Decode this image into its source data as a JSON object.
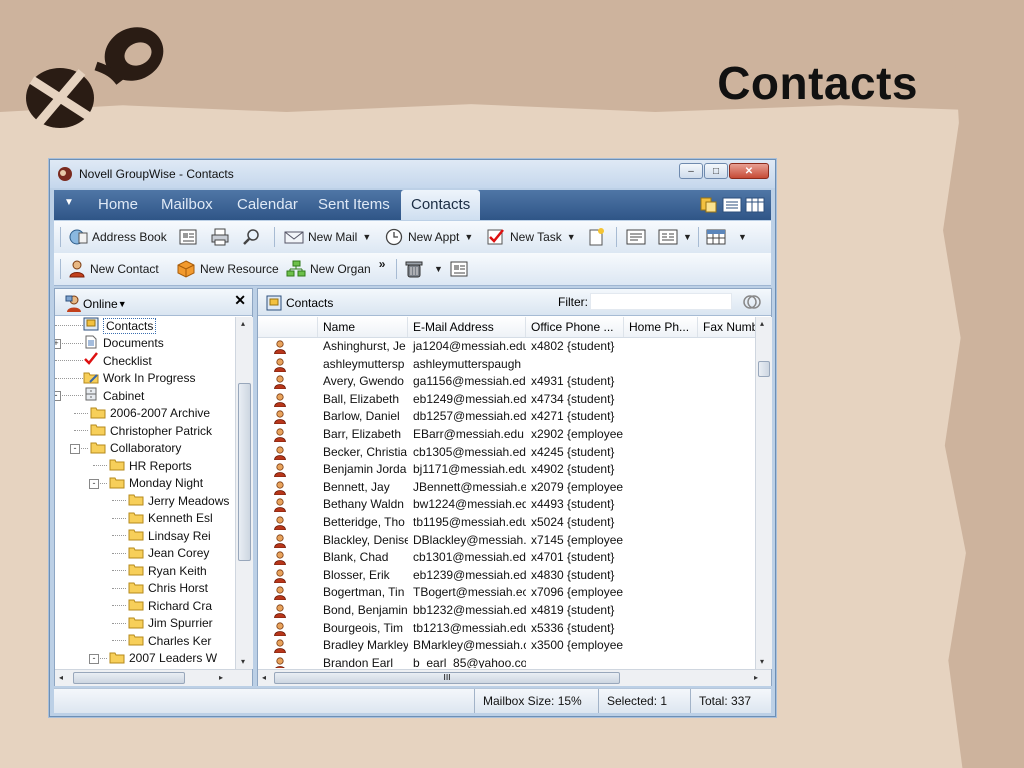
{
  "slide": {
    "title": "Contacts"
  },
  "window": {
    "title": "Novell GroupWise - Contacts",
    "controls": {
      "minimize": "–",
      "maximize": "□",
      "close": "✕"
    }
  },
  "nav": {
    "tabs": [
      {
        "label": "Home",
        "active": false
      },
      {
        "label": "Mailbox",
        "active": false
      },
      {
        "label": "Calendar",
        "active": false
      },
      {
        "label": "Sent Items",
        "active": false
      },
      {
        "label": "Contacts",
        "active": true
      }
    ]
  },
  "toolbar": {
    "address_book": "Address Book",
    "new_mail": "New Mail",
    "new_appt": "New Appt",
    "new_task": "New Task",
    "new_contact": "New Contact",
    "new_resource": "New Resource",
    "new_organ": "New Organ",
    "overflow": "»"
  },
  "folder_pane": {
    "mode": "Online",
    "close": "✕",
    "items": [
      {
        "label": "Contacts",
        "selected": true
      },
      {
        "label": "Documents"
      },
      {
        "label": "Checklist"
      },
      {
        "label": "Work In Progress"
      },
      {
        "label": "Cabinet"
      },
      {
        "label": "2006-2007 Archive"
      },
      {
        "label": "Christopher Patrick"
      },
      {
        "label": "Collaboratory"
      },
      {
        "label": "HR Reports"
      },
      {
        "label": "Monday Night"
      },
      {
        "label": "Jerry Meadows"
      },
      {
        "label": "Kenneth Esl"
      },
      {
        "label": "Lindsay Rei"
      },
      {
        "label": "Jean Corey"
      },
      {
        "label": "Ryan Keith"
      },
      {
        "label": "Chris Horst"
      },
      {
        "label": "Richard Cra"
      },
      {
        "label": "Jim Spurrier"
      },
      {
        "label": "Charles Ker"
      },
      {
        "label": "2007 Leaders W"
      }
    ]
  },
  "contacts_pane": {
    "title": "Contacts",
    "filter_label": "Filter:",
    "filter_value": "",
    "columns": [
      "Name",
      "E-Mail Address",
      "Office Phone ...",
      "Home Ph...",
      "Fax Numb"
    ],
    "rows": [
      [
        "Ashinghurst, Je",
        "ja1204@messiah.edu",
        "x4802 {student}"
      ],
      [
        "ashleymuttersp",
        "ashleymutterspaugh",
        ""
      ],
      [
        "Avery, Gwendo",
        "ga1156@messiah.edu",
        "x4931 {student}"
      ],
      [
        "Ball, Elizabeth",
        "eb1249@messiah.edu",
        "x4734 {student}"
      ],
      [
        "Barlow, Daniel",
        "db1257@messiah.ed",
        "x4271 {student}"
      ],
      [
        "Barr, Elizabeth",
        "EBarr@messiah.edu",
        "x2902 {employee"
      ],
      [
        "Becker, Christia",
        "cb1305@messiah.edu",
        "x4245 {student}"
      ],
      [
        "Benjamin Jorda",
        "bj1171@messiah.edu",
        "x4902 {student}"
      ],
      [
        "Bennett, Jay",
        "JBennett@messiah.e",
        "x2079 {employee"
      ],
      [
        "Bethany Waldn",
        "bw1224@messiah.ed",
        "x4493 {student}"
      ],
      [
        "Betteridge, Tho",
        "tb1195@messiah.edu",
        "x5024 {student}"
      ],
      [
        "Blackley, Denise",
        "DBlackley@messiah.",
        "x7145 {employee"
      ],
      [
        "Blank, Chad",
        "cb1301@messiah.edu",
        "x4701 {student}"
      ],
      [
        "Blosser, Erik",
        "eb1239@messiah.edu",
        "x4830 {student}"
      ],
      [
        "Bogertman, Tin",
        "TBogert@messiah.ec",
        "x7096 {employee"
      ],
      [
        "Bond, Benjamin",
        "bb1232@messiah.ed",
        "x4819 {student}"
      ],
      [
        "Bourgeois, Tim",
        "tb1213@messiah.edu",
        "x5336 {student}"
      ],
      [
        "Bradley Markley",
        "BMarkley@messiah.c",
        "x3500 {employee"
      ],
      [
        "Brandon Earl",
        "b_earl_85@yahoo.co",
        ""
      ]
    ]
  },
  "status": {
    "mailbox_size": "Mailbox Size: 15%",
    "selected": "Selected: 1",
    "total": "Total: 337"
  },
  "scroll": {
    "h_arrow_left": "◂",
    "h_arrow_right": "▸",
    "v_arrow_up": "▴",
    "v_arrow_down": "▾",
    "grip": "III"
  }
}
